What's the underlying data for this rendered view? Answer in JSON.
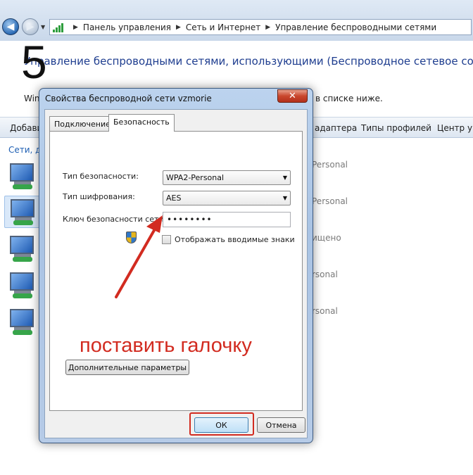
{
  "explorer": {
    "breadcrumb": [
      "Панель управления",
      "Сеть и Интернет",
      "Управление беспроводными сетями"
    ],
    "step_number": "5",
    "heading": "Управление беспроводными сетями, использующими (Беспроводное сетевое соединени",
    "subtext_left": "Win",
    "subtext_right": "в списке ниже.",
    "toolbar": {
      "left_label": "Добави",
      "adapter_label": "адаптера",
      "profile_types_label": "Типы профилей",
      "center_label": "Центр уп"
    },
    "networks_header": "Сети, до",
    "network_statuses": [
      "Personal",
      "Personal",
      "ищено",
      "rsonal",
      "rsonal"
    ]
  },
  "dialog": {
    "title": "Свойства беспроводной сети vzmorie",
    "close_symbol": "✕",
    "tabs": [
      {
        "label": "Подключение",
        "active": false
      },
      {
        "label": "Безопасность",
        "active": true
      }
    ],
    "security_type_label": "Тип безопасности:",
    "security_type_value": "WPA2-Personal",
    "encryption_type_label": "Тип шифрования:",
    "encryption_type_value": "AES",
    "key_label": "Ключ безопасности сети",
    "key_value": "••••••••",
    "show_chars_label": "Отображать вводимые знаки",
    "show_chars_checked": false,
    "advanced_button": "Дополнительные параметры",
    "ok_button": "ОК",
    "cancel_button": "Отмена"
  },
  "annotation": {
    "text": "поставить галочку",
    "color": "#d22b20"
  },
  "icons": {
    "back": "back-arrow-icon",
    "forward": "forward-arrow-icon",
    "address": "network-bars-icon",
    "network": "wireless-network-icon",
    "uac": "uac-shield-icon"
  }
}
